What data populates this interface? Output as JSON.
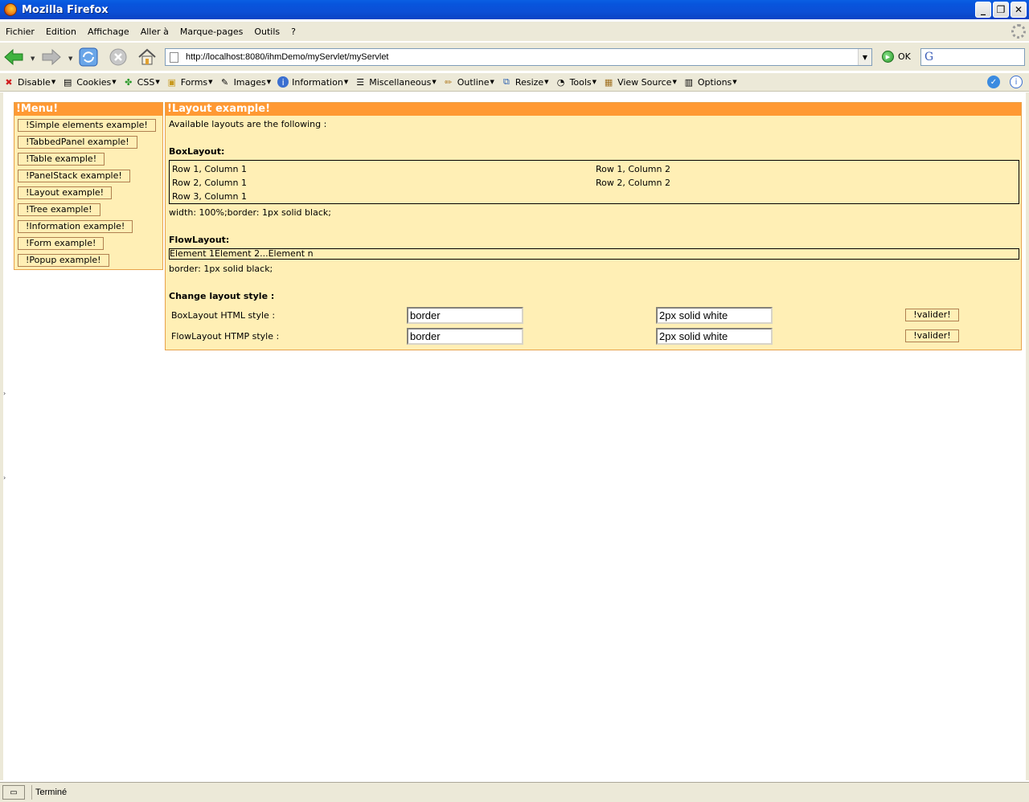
{
  "window": {
    "title": "Mozilla Firefox"
  },
  "menubar": {
    "items": [
      "Fichier",
      "Edition",
      "Affichage",
      "Aller à",
      "Marque-pages",
      "Outils",
      "?"
    ]
  },
  "navbar": {
    "url": "http://localhost:8080/ihmDemo/myServlet/myServlet",
    "go_label": "OK",
    "search_value": ""
  },
  "devbar": {
    "items": [
      "Disable",
      "Cookies",
      "CSS",
      "Forms",
      "Images",
      "Information",
      "Miscellaneous",
      "Outline",
      "Resize",
      "Tools",
      "View Source",
      "Options"
    ]
  },
  "menu": {
    "title": "!Menu!",
    "items": [
      "!Simple elements example!",
      "!TabbedPanel example!",
      "!Table example!",
      "!PanelStack example!",
      "!Layout example!",
      "!Tree example!",
      "!Information example!",
      "!Form example!",
      "!Popup example!"
    ]
  },
  "layout": {
    "title": "!Layout example!",
    "intro": "Available layouts are the following :",
    "boxlayout": {
      "heading": "BoxLayout:",
      "cells": [
        [
          "Row 1, Column 1",
          "Row 1, Column 2"
        ],
        [
          "Row 2, Column 1",
          "Row 2, Column 2"
        ],
        [
          "Row 3, Column 1",
          ""
        ]
      ],
      "style": "width: 100%;border: 1px solid black;"
    },
    "flowlayout": {
      "heading": "FlowLayout:",
      "content": "Element 1Element 2...Element n",
      "style": "border: 1px solid black;"
    },
    "change": {
      "heading": "Change layout style :",
      "rows": [
        {
          "label": "BoxLayout HTML style :",
          "property": "border",
          "value": "2px solid white",
          "button": "!valider!"
        },
        {
          "label": "FlowLayout HTMP style :",
          "property": "border",
          "value": "2px solid white",
          "button": "!valider!"
        }
      ]
    }
  },
  "status": {
    "text": "Terminé"
  }
}
